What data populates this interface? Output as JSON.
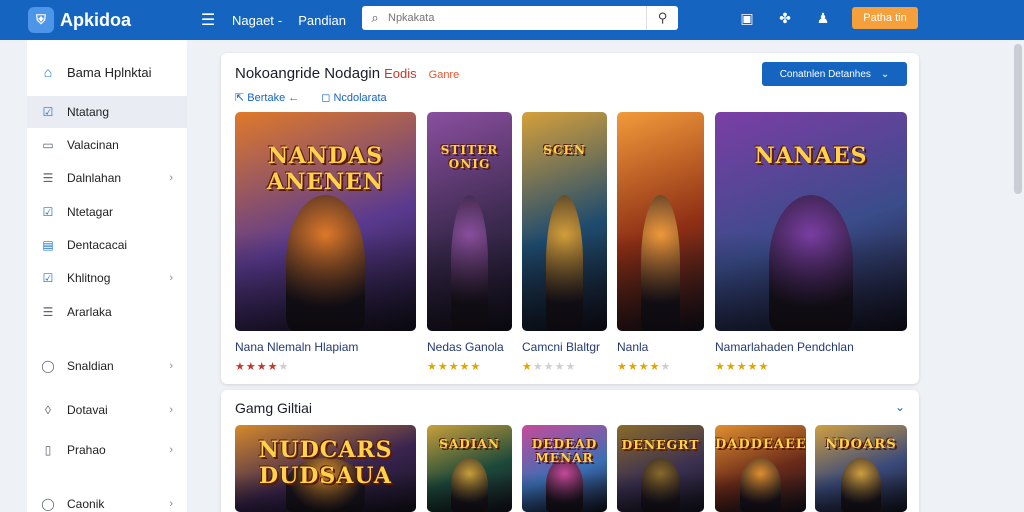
{
  "app": {
    "title": "Apkidoa"
  },
  "topbar": {
    "nav": [
      "Nagaet",
      "Pandian"
    ],
    "nav_separator": "-",
    "search_placeholder": "Npkakata",
    "cta_label": "Patha tin",
    "icons": [
      "menu-icon",
      "window-icon",
      "puzzle-icon",
      "account-icon"
    ]
  },
  "sidebar": {
    "home": "Bama Hplnktai",
    "items": [
      {
        "label": "Ntatang",
        "icon": "checkbox-icon",
        "active": true,
        "chevron": false
      },
      {
        "label": "Valacinan",
        "icon": "folder-icon",
        "active": false,
        "chevron": false
      },
      {
        "label": "Dalnlahan",
        "icon": "list-icon",
        "active": false,
        "chevron": true
      },
      {
        "label": "Ntetagar",
        "icon": "checkbox-icon",
        "active": false,
        "chevron": false
      },
      {
        "label": "Dentacacai",
        "icon": "grid-icon",
        "active": false,
        "chevron": false
      },
      {
        "label": "Khlitnog",
        "icon": "checkbox-icon",
        "active": false,
        "chevron": true
      },
      {
        "label": "Ararlaka",
        "icon": "list-icon",
        "active": false,
        "chevron": false
      },
      {
        "label": "Snaldian",
        "icon": "circle-icon",
        "active": false,
        "chevron": true
      },
      {
        "label": "Dotavai",
        "icon": "droplet-icon",
        "active": false,
        "chevron": true
      },
      {
        "label": "Prahao",
        "icon": "document-icon",
        "active": false,
        "chevron": true
      },
      {
        "label": "Caonik",
        "icon": "circle-icon",
        "active": false,
        "chevron": true
      }
    ]
  },
  "featured": {
    "title": "Nokoangride Nodagin",
    "tag1": "Eodis",
    "tag2": "Ganre",
    "sub_left": "Bertake  ←",
    "sub_right": "Ncdolarata",
    "dropdown_label": "Conatnlen Detanhes",
    "cards": [
      {
        "art": "NANDAS ANENEN",
        "palette": [
          "#5a3a8f",
          "#e07a2a"
        ]
      },
      {
        "art": "STITER ONIG",
        "palette": [
          "#3b2a4f",
          "#8a4f9e"
        ]
      },
      {
        "art": "SCEN",
        "palette": [
          "#1f4b6e",
          "#d5a03b"
        ]
      },
      {
        "art": "",
        "palette": [
          "#8e2f15",
          "#f29a3b"
        ]
      },
      {
        "art": "NANAES",
        "palette": [
          "#3a4c8a",
          "#7b3ea5"
        ]
      }
    ],
    "games": [
      {
        "label": "Nana Nlemaln Hlapiam",
        "rating": 4,
        "star_color": "#c0392b"
      },
      {
        "label": "Nedas Ganola",
        "rating": 5,
        "star_color": "#e2a400"
      },
      {
        "label": "Camcni Blaltgr",
        "rating": 1,
        "star_color": "#e2a400"
      },
      {
        "label": "Nanla",
        "rating": 4,
        "star_color": "#e2a400"
      },
      {
        "label": "Namarlahaden Pendchlan",
        "rating": 5,
        "star_color": "#e2a400"
      }
    ]
  },
  "section2": {
    "title": "Gamg Giltiai",
    "cards": [
      {
        "art": "NUDCARS DUDSAUA",
        "palette": [
          "#3a2450",
          "#d58a2b"
        ]
      },
      {
        "art": "SADIAN",
        "palette": [
          "#1d4a3a",
          "#c9a03a"
        ]
      },
      {
        "art": "DEDEAD MENAR",
        "palette": [
          "#3a6fb5",
          "#c74a9a"
        ]
      },
      {
        "art": "DENEGRT",
        "palette": [
          "#3a3050",
          "#8a6a2a"
        ]
      },
      {
        "art": "DADDEAEEO",
        "palette": [
          "#6a2a1a",
          "#e09030"
        ]
      },
      {
        "art": "NDOARS",
        "palette": [
          "#3a4a7a",
          "#d0a040"
        ]
      }
    ]
  }
}
